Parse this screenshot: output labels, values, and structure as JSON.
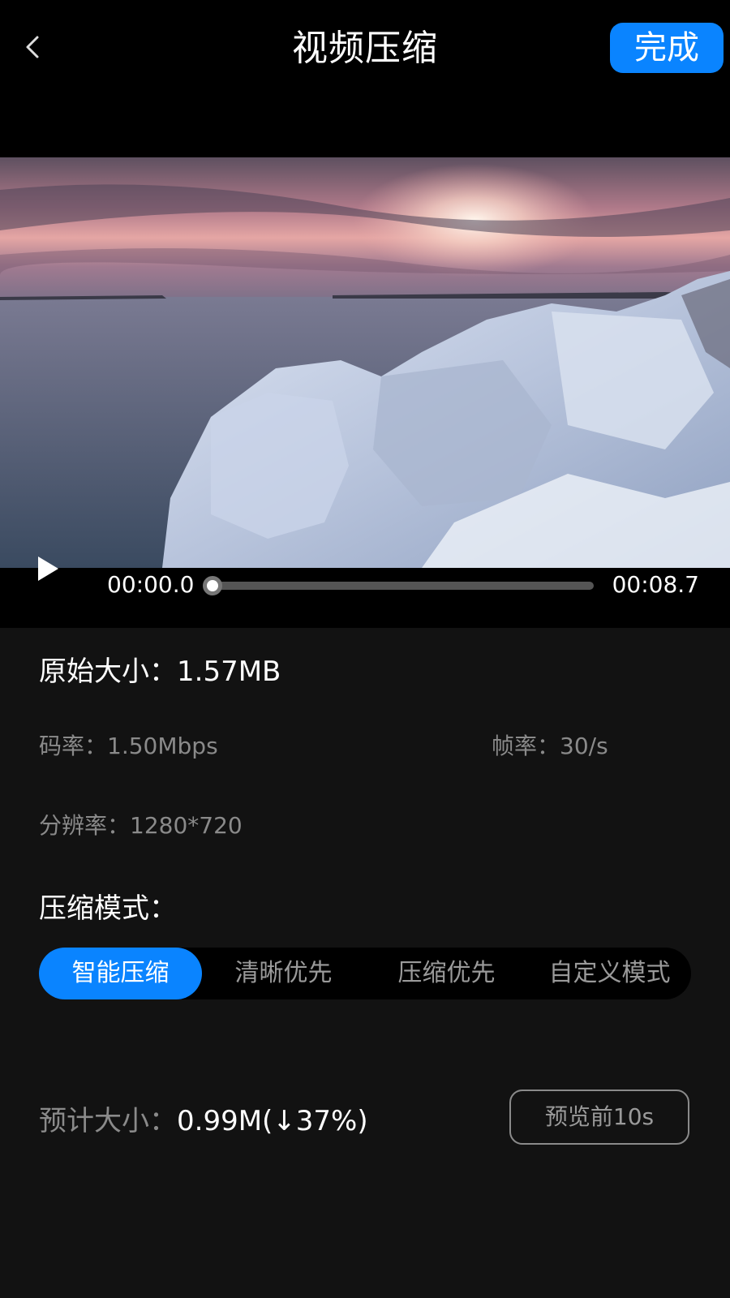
{
  "header": {
    "title": "视频压缩",
    "done_label": "完成"
  },
  "player": {
    "current_time": "00:00.0",
    "duration": "00:08.7",
    "progress": 0
  },
  "info": {
    "original_size_label": "原始大小：",
    "original_size_value": "1.57MB",
    "bitrate_label": "码率：",
    "bitrate_value": "1.50Mbps",
    "framerate_label": "帧率：",
    "framerate_value": "30/s",
    "resolution_label": "分辨率：",
    "resolution_value": "1280*720"
  },
  "compression": {
    "mode_label": "压缩模式：",
    "modes": [
      "智能压缩",
      "清晰优先",
      "压缩优先",
      "自定义模式"
    ],
    "selected_index": 0
  },
  "estimate": {
    "label": "预计大小：",
    "value": "0.99M(↓37%)"
  },
  "preview_label": "预览前10s",
  "colors": {
    "accent": "#0a84ff",
    "background": "#121212",
    "muted_text": "#8a8a8a"
  },
  "icons": {
    "back": "chevron-left-icon",
    "play": "play-icon"
  }
}
